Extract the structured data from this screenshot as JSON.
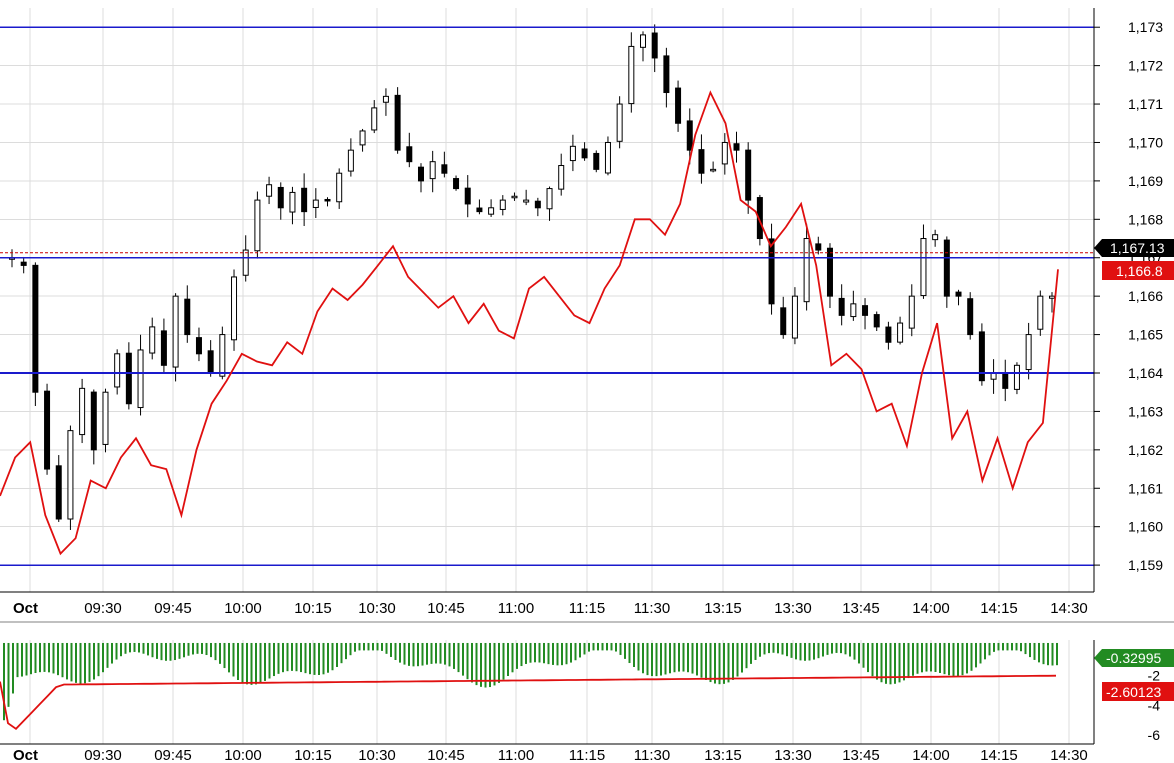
{
  "chart_data": [
    {
      "type": "candlestick",
      "x_ticks": [
        "Oct",
        "09:30",
        "09:45",
        "10:00",
        "10:15",
        "10:30",
        "10:45",
        "11:00",
        "11:15",
        "11:30",
        "13:15",
        "13:30",
        "13:45",
        "14:00",
        "14:15",
        "14:30"
      ],
      "y_ticks": [
        "1,159",
        "1,160",
        "1,161",
        "1,162",
        "1,163",
        "1,164",
        "1,165",
        "1,166",
        "1,167",
        "1,168",
        "1,169",
        "1,170",
        "1,171",
        "1,172",
        "1,173"
      ],
      "ylim": [
        1158.3,
        1173.5
      ],
      "horizontal_lines": [
        1173.0,
        1167.0,
        1164.0,
        1159.0
      ],
      "dashed_line": 1167.13,
      "last_price_tag": "1,167.13",
      "red_line_tag": "1,166.8",
      "close_series": [
        1167.0,
        1166.8,
        1163.5,
        1161.5,
        1160.2,
        1162.5,
        1163.6,
        1162.0,
        1163.5,
        1164.5,
        1163.2,
        1164.6,
        1165.2,
        1164.2,
        1166.0,
        1165.0,
        1164.5,
        1164.0,
        1165.0,
        1166.5,
        1167.2,
        1168.5,
        1168.9,
        1168.3,
        1168.7,
        1168.2,
        1168.5,
        1168.5,
        1169.2,
        1169.8,
        1170.3,
        1170.9,
        1171.2,
        1169.8,
        1169.5,
        1169.0,
        1169.5,
        1169.2,
        1168.8,
        1168.4,
        1168.2,
        1168.3,
        1168.5,
        1168.6,
        1168.5,
        1168.3,
        1168.8,
        1169.4,
        1169.9,
        1169.6,
        1169.3,
        1170.0,
        1171.0,
        1172.5,
        1172.8,
        1172.2,
        1171.3,
        1170.5,
        1169.8,
        1169.2,
        1169.3,
        1170.0,
        1169.8,
        1168.5,
        1167.5,
        1165.8,
        1165.0,
        1166.0,
        1167.5,
        1167.2,
        1166.0,
        1165.5,
        1165.8,
        1165.5,
        1165.2,
        1164.8,
        1165.3,
        1166.0,
        1167.5,
        1167.6,
        1166.0,
        1166.0,
        1165.0,
        1163.8,
        1164.0,
        1163.6,
        1164.2,
        1165.0,
        1166.0,
        1166.0
      ],
      "red_series": [
        1160.8,
        1161.8,
        1162.2,
        1160.3,
        1159.3,
        1159.7,
        1161.2,
        1161.0,
        1161.8,
        1162.3,
        1161.6,
        1161.5,
        1160.3,
        1162.0,
        1163.2,
        1163.8,
        1164.5,
        1164.3,
        1164.2,
        1164.8,
        1164.5,
        1165.6,
        1166.2,
        1165.9,
        1166.3,
        1166.8,
        1167.3,
        1166.5,
        1166.1,
        1165.7,
        1166.0,
        1165.3,
        1165.8,
        1165.1,
        1164.9,
        1166.2,
        1166.5,
        1166.0,
        1165.5,
        1165.3,
        1166.2,
        1166.8,
        1168.0,
        1168.0,
        1167.6,
        1168.4,
        1170.2,
        1171.3,
        1170.5,
        1168.5,
        1168.2,
        1167.3,
        1167.8,
        1168.4,
        1166.8,
        1164.2,
        1164.5,
        1164.1,
        1163.0,
        1163.2,
        1162.1,
        1164.0,
        1165.3,
        1162.3,
        1163.0,
        1161.2,
        1162.3,
        1161.0,
        1162.2,
        1162.7,
        1166.7
      ]
    },
    {
      "type": "bar",
      "x_ticks": [
        "Oct",
        "09:30",
        "09:45",
        "10:00",
        "10:15",
        "10:30",
        "10:45",
        "11:00",
        "11:15",
        "11:30",
        "13:15",
        "13:30",
        "13:45",
        "14:00",
        "14:15",
        "14:30"
      ],
      "y_ticks": [
        "-6",
        "-4",
        "-2"
      ],
      "ylim": [
        -6.6,
        0.4
      ],
      "histogram_tag": "-0.32995",
      "signal_tag": "-2.60123",
      "histogram_color": "#228b22",
      "signal_color": "#e01010"
    }
  ]
}
